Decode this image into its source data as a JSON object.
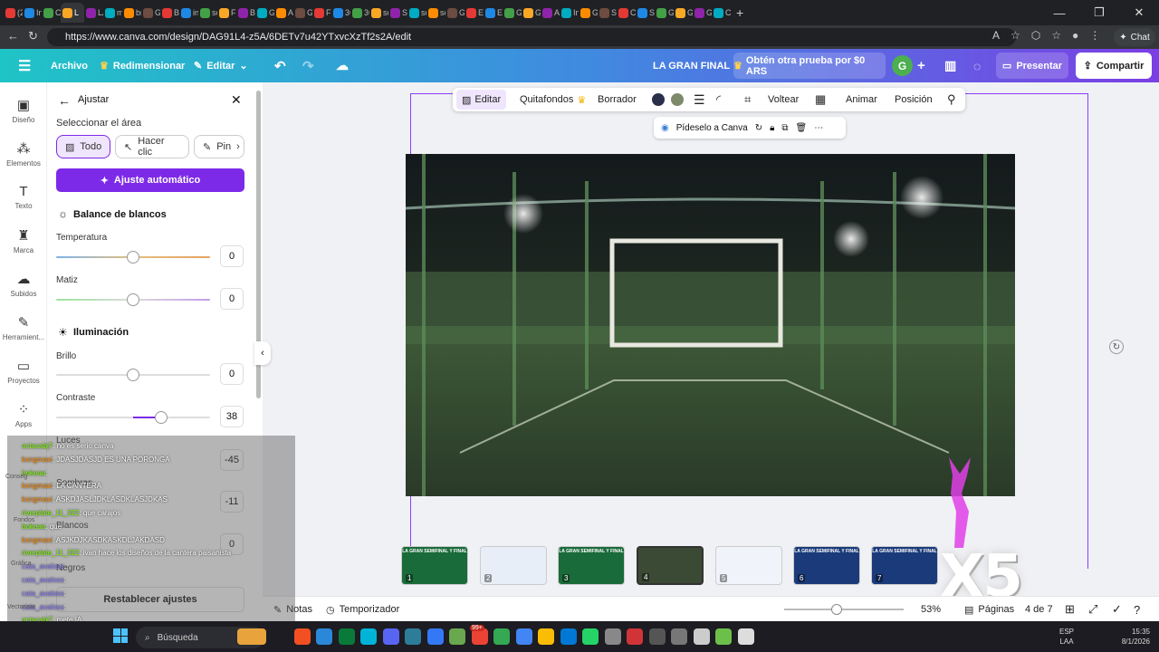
{
  "browser": {
    "tabs": [
      "(2",
      "In",
      "Cl",
      "L",
      "LA",
      "m",
      "br",
      "G",
      "Bl",
      "in",
      "sc",
      "Fl",
      "Bl",
      "G",
      "Ai",
      "G",
      "Fr",
      "3C",
      "3C",
      "sc",
      "S",
      "sc",
      "sc",
      "G",
      "Er",
      "Er",
      "G",
      "G",
      "A",
      "In",
      "G",
      "S",
      "C",
      "Sl",
      "G",
      "G",
      "G",
      "C"
    ],
    "url": "https://www.canva.com/design/DAG91L4-z5A/6DETv7u42YTxvcXzTf2s2A/edit",
    "chat": "Chat"
  },
  "header": {
    "menu_icon": "menu-icon",
    "archivo": "Archivo",
    "redimensionar": "Redimensionar",
    "editar": "Editar",
    "title": "LA GRAN FINAL",
    "trial": "Obtén otra prueba por $0 ARS",
    "avatar": "G",
    "presentar": "Presentar",
    "compartir": "Compartir"
  },
  "sidebar": [
    {
      "label": "Diseño",
      "icon": "design-icon"
    },
    {
      "label": "Elementos",
      "icon": "elements-icon"
    },
    {
      "label": "Texto",
      "icon": "text-icon"
    },
    {
      "label": "Marca",
      "icon": "brand-icon"
    },
    {
      "label": "Subidos",
      "icon": "upload-icon"
    },
    {
      "label": "Herramient...",
      "icon": "tools-icon"
    },
    {
      "label": "Proyectos",
      "icon": "folder-icon"
    },
    {
      "label": "Apps",
      "icon": "apps-icon"
    }
  ],
  "panel": {
    "title": "Ajustar",
    "select_area": "Seleccionar el área",
    "chips": [
      "Todo",
      "Hacer clic",
      "Pin"
    ],
    "auto": "Ajuste automático",
    "wb": "Balance de blancos",
    "temperatura": "Temperatura",
    "temperatura_val": "0",
    "matiz": "Matiz",
    "matiz_val": "0",
    "iluminacion": "Iluminación",
    "brillo": "Brillo",
    "brillo_val": "0",
    "contraste": "Contraste",
    "contraste_val": "38",
    "luces": "Luces",
    "luces_val": "-45",
    "sombras": "Sombras",
    "sombras_val": "-11",
    "blancos": "Blancos",
    "blancos_val": "0",
    "negros": "Negros",
    "reset": "Restablecer ajustes"
  },
  "toolbar": {
    "editar": "Editar",
    "quitafondos": "Quitafondos",
    "borrador": "Borrador",
    "voltear": "Voltear",
    "animar": "Animar",
    "posicion": "Posición",
    "colors": [
      "#2b2f4a",
      "#7c8a6a"
    ]
  },
  "ask": {
    "label": "Pídeselo a Canva"
  },
  "thumbs": [
    "1",
    "2",
    "3",
    "4",
    "5",
    "6",
    "7"
  ],
  "thumb_title": "LA GRAN SEMIFINAL Y FINAL",
  "footer": {
    "notas": "Notas",
    "temporizador": "Temporizador",
    "zoom": "53%",
    "paginas": "Páginas",
    "page_of": "4 de 7"
  },
  "chat": [
    {
      "user": "octacabj7",
      "text": ": no es serio canva",
      "color": "#7CFC00"
    },
    {
      "user": "kxngmaxi",
      "text": ": JDASJDASJD ES UNA PORONGA",
      "color": "#ff8c00"
    },
    {
      "user": "bokeaa",
      "text": ":",
      "color": "#7CFC00"
    },
    {
      "user": "kxngmaxi",
      "text": ": LA CANTERA",
      "color": "#ff8c00"
    },
    {
      "user": "kxngmaxi",
      "text": ": ASKDJASLJDKLASDKLASJDKAS",
      "color": "#ff8c00"
    },
    {
      "user": "riverplate_11_322",
      "text": ": que carajos",
      "color": "#7CFC00"
    },
    {
      "user": "bokeaa",
      "text": ": que",
      "color": "#7CFC00"
    },
    {
      "user": "kxngmaxi",
      "text": ": ASJKDJKASDKASKDLJAKDASD",
      "color": "#ff8c00"
    },
    {
      "user": "riverplate_11_322",
      "text": ": ivan hace los diseños de la cantera paisanista",
      "color": "#7CFC00"
    },
    {
      "user": "cata_avaloss",
      "text": ":",
      "color": "#8a7dff"
    },
    {
      "user": "cata_avaloss",
      "text": ":",
      "color": "#8a7dff"
    },
    {
      "user": "cata_avaloss",
      "text": ":",
      "color": "#8a7dff"
    },
    {
      "user": "cata_avaloss",
      "text": ":",
      "color": "#8a7dff"
    },
    {
      "user": "octacabj7",
      "text": ": mete IA",
      "color": "#7CFC00"
    },
    {
      "user": "cata_avaloss",
      "text": ":",
      "color": "#8a7dff"
    }
  ],
  "overlay": {
    "x5": "X5"
  },
  "sidebar_partial": [
    "Conseg",
    "Fondos",
    "Gráfica",
    "Vectorizar"
  ],
  "taskbar": {
    "search": "Búsqueda",
    "lang1": "ESP",
    "lang2": "LAA",
    "time": "15:35",
    "date": "8/1/2026",
    "badge": "99+"
  },
  "accent": "#7d2ae8"
}
